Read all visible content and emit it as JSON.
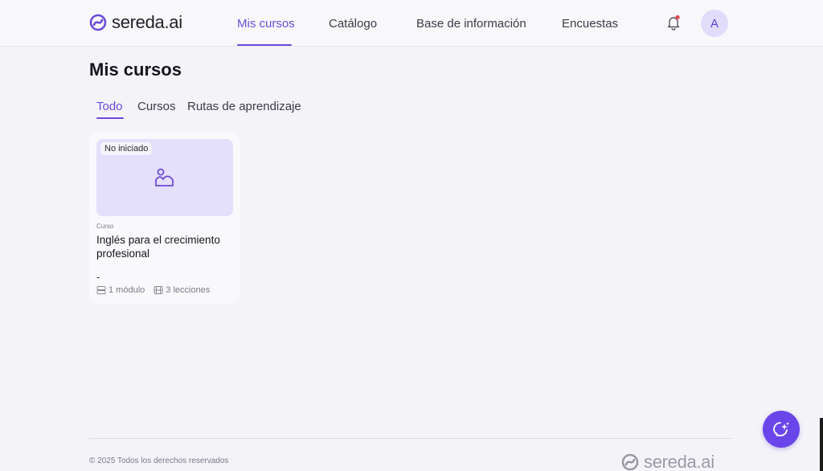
{
  "header": {
    "logo_text": "sereda.ai",
    "nav": [
      {
        "label": "Mis cursos",
        "active": true
      },
      {
        "label": "Catálogo",
        "active": false
      },
      {
        "label": "Base de información",
        "active": false
      },
      {
        "label": "Encuestas",
        "active": false
      }
    ],
    "avatar_initial": "A",
    "notification_icon": "bell-icon"
  },
  "page": {
    "title": "Mis cursos",
    "tabs": [
      {
        "label": "Todo",
        "active": true
      },
      {
        "label": "Cursos",
        "active": false
      },
      {
        "label": "Rutas de aprendizaje",
        "active": false
      }
    ]
  },
  "courses": [
    {
      "status": "No iniciado",
      "type": "Curso",
      "title": "Inglés para el crecimiento profesional",
      "subtitle": "-",
      "modules": "1 módulo",
      "lessons": "3 lecciones"
    }
  ],
  "footer": {
    "copyright": "© 2025 Todos los derechos reservados",
    "logo_text": "sereda.ai"
  },
  "colors": {
    "accent": "#6b4bd8",
    "fab": "#6a46ea",
    "card_image_bg": "#e4dffb",
    "notification_dot": "#e5484d"
  }
}
